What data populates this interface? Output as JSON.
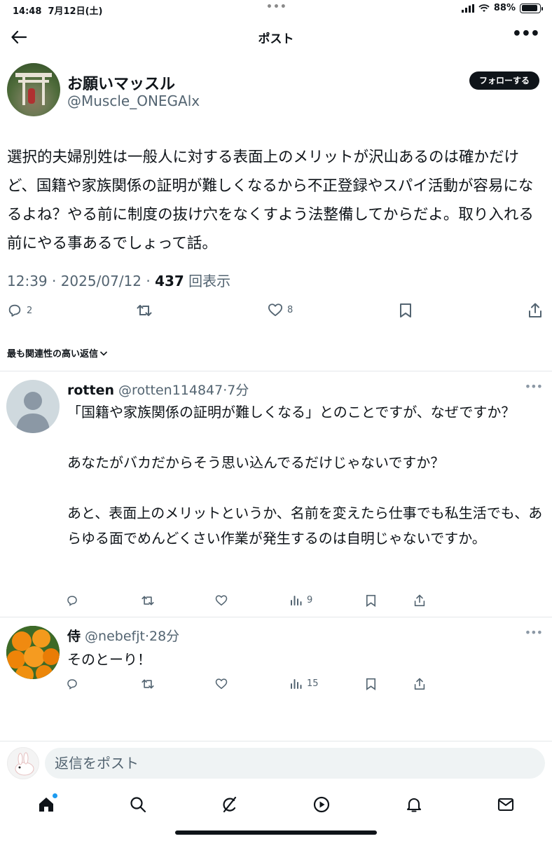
{
  "status_bar": {
    "time": "14:48",
    "date": "7月12日(土)",
    "battery": "88%",
    "battery_level": 0.88
  },
  "header": {
    "title": "ポスト"
  },
  "post": {
    "author_name": "お願いマッスル",
    "author_handle": "@Muscle_ONEGAlx",
    "follow_label": "フォローする",
    "text": "選択的夫婦別姓は一般人に対する表面上のメリットが沢山あるのは確かだけど、国籍や家族関係の証明が難しくなるから不正登録やスパイ活動が容易になるよね？やる前に制度の抜け穴をなくすよう法整備してからだよ。取り入れる前にやる事あるでしょって話。",
    "timestamp": "12:39 · 2025/07/12 · ",
    "views": "437",
    "views_label": " 回表示",
    "reply_count": "2",
    "like_count": "8"
  },
  "sort_label": "最も関連性の高い返信",
  "replies": [
    {
      "name": "rotten",
      "handle_time": " @rotten114847·7分",
      "text": "「国籍や家族関係の証明が難しくなる」とのことですが、なぜですか？\n\nあなたがバカだからそう思い込んでるだけじゃないですか？\n\nあと、表面上のメリットというか、名前を変えたら仕事でも私生活でも、あらゆる面でめんどくさい作業が発生するのは自明じゃないですか。",
      "views": "9"
    },
    {
      "name": "侍",
      "handle_time": " @nebefjt·28分",
      "text": "そのとーり！",
      "views": "15"
    }
  ],
  "composer": {
    "placeholder": "返信をポスト"
  },
  "colors": {
    "text": "#0f1419",
    "muted": "#536471",
    "accent": "#1d9bf0"
  }
}
